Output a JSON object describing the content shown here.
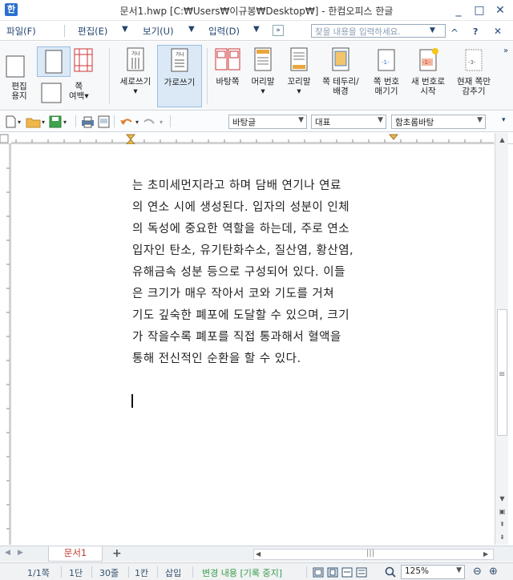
{
  "app": {
    "icon_glyph": "한",
    "title": "문서1.hwp [C:₩Users₩이규봉₩Desktop₩] - 한컴오피스 한글",
    "brand_color": "#2c6fd1"
  },
  "window_controls": {
    "minimize": "_",
    "maximize": "□",
    "close": "✕"
  },
  "menu": {
    "items": [
      "파일(F)",
      "편집(E)",
      "보기(U)",
      "입력(D)"
    ],
    "more": "»",
    "search_placeholder": "찾을 내용을 입력하세요.",
    "ribbon_collapse": "^",
    "help": "?",
    "close_doc": "✕"
  },
  "ribbon": {
    "buttons": [
      {
        "label": "편집\n용지"
      },
      {
        "label": "쪽\n여백▾"
      },
      {
        "label": "세로쓰기\n▾"
      },
      {
        "label": "가로쓰기"
      },
      {
        "label": "바탕쪽"
      },
      {
        "label": "머리말\n▾"
      },
      {
        "label": "꼬리말\n▾"
      },
      {
        "label": "쪽 테두리/\n배경"
      },
      {
        "label": "쪽 번호\n매기기"
      },
      {
        "label": "새 번호로\n시작"
      },
      {
        "label": "현재 쪽만\n감추기"
      }
    ],
    "icon_text": {
      "vertical": "가나",
      "horizontal": "가나",
      "page_num": "-1-",
      "new_num": "-1-",
      "hide": "-3-"
    },
    "overflow": "»"
  },
  "toolbar": {
    "style_combo": "바탕글",
    "font_lang_combo": "대표",
    "font_combo": "함초롬바탕",
    "overflow": "▾"
  },
  "document": {
    "lines": [
      "는 초미세먼지라고 하며 담배 연기나 연료",
      "의 연소 시에 생성된다. 입자의 성분이 인체",
      "의 독성에 중요한 역할을 하는데, 주로 연소",
      "입자인 탄소, 유기탄화수소, 질산염, 황산염,",
      "유해금속 성분 등으로 구성되어 있다. 이들",
      "은 크기가 매우 작아서 코와 기도를 거쳐",
      "기도 깊숙한 폐포에 도달할 수 있으며, 크기",
      "가 작을수록 폐포를 직접 통과해서 혈액을",
      "통해 전신적인 순환을 할 수 있다."
    ]
  },
  "tabs": {
    "active": "문서1",
    "add": "+"
  },
  "status": {
    "page": "1/1쪽",
    "section": "1단",
    "line": "30줄",
    "column": "1칸",
    "insert": "삽입",
    "track_changes": "변경 내용 [기록 중지]",
    "zoom": "125%",
    "zoom_out": "⊖",
    "zoom_in": "⊕"
  }
}
